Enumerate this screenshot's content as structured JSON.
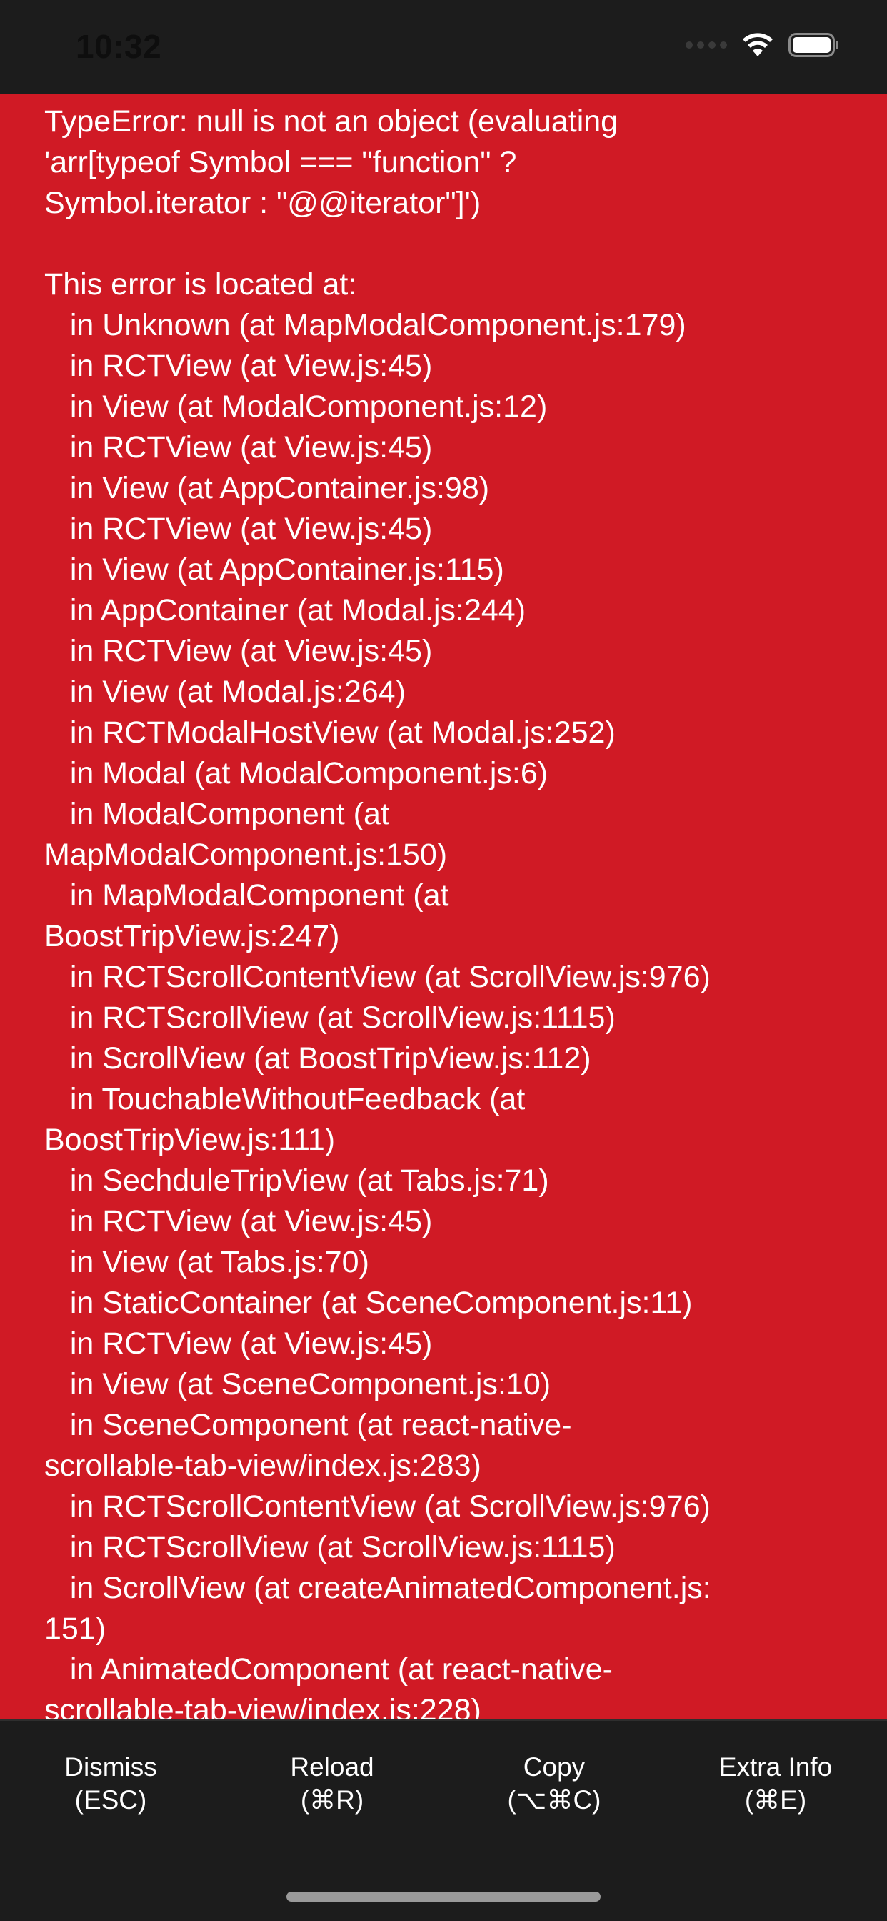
{
  "status_bar": {
    "time": "10:32",
    "icons": [
      "signal-dots-icon",
      "wifi-icon",
      "battery-icon"
    ]
  },
  "error": {
    "background_color": "#d01a25",
    "message": "TypeError: null is not an object (evaluating\n'arr[typeof Symbol === \"function\" ?\nSymbol.iterator : \"@@iterator\"]')",
    "located_header": "This error is located at:",
    "stack": [
      "   in Unknown (at MapModalComponent.js:179)",
      "   in RCTView (at View.js:45)",
      "   in View (at ModalComponent.js:12)",
      "   in RCTView (at View.js:45)",
      "   in View (at AppContainer.js:98)",
      "   in RCTView (at View.js:45)",
      "   in View (at AppContainer.js:115)",
      "   in AppContainer (at Modal.js:244)",
      "   in RCTView (at View.js:45)",
      "   in View (at Modal.js:264)",
      "   in RCTModalHostView (at Modal.js:252)",
      "   in Modal (at ModalComponent.js:6)",
      "   in ModalComponent (at\nMapModalComponent.js:150)",
      "   in MapModalComponent (at\nBoostTripView.js:247)",
      "   in RCTScrollContentView (at ScrollView.js:976)",
      "   in RCTScrollView (at ScrollView.js:1115)",
      "   in ScrollView (at BoostTripView.js:112)",
      "   in TouchableWithoutFeedback (at\nBoostTripView.js:111)",
      "   in SechduleTripView (at Tabs.js:71)",
      "   in RCTView (at View.js:45)",
      "   in View (at Tabs.js:70)",
      "   in StaticContainer (at SceneComponent.js:11)",
      "   in RCTView (at View.js:45)",
      "   in View (at SceneComponent.js:10)",
      "   in SceneComponent (at react-native-\nscrollable-tab-view/index.js:283)",
      "   in RCTScrollContentView (at ScrollView.js:976)",
      "   in RCTScrollView (at ScrollView.js:1115)",
      "   in ScrollView (at createAnimatedComponent.js:\n151)",
      "   in AnimatedComponent (at react-native-\nscrollable-tab-view/index.js:228)"
    ]
  },
  "toolbar": {
    "dismiss": {
      "label": "Dismiss",
      "shortcut": "(ESC)"
    },
    "reload": {
      "label": "Reload",
      "shortcut": "(⌘R)"
    },
    "copy": {
      "label": "Copy",
      "shortcut": "(⌥⌘C)"
    },
    "extra_info": {
      "label": "Extra Info",
      "shortcut": "(⌘E)"
    }
  }
}
